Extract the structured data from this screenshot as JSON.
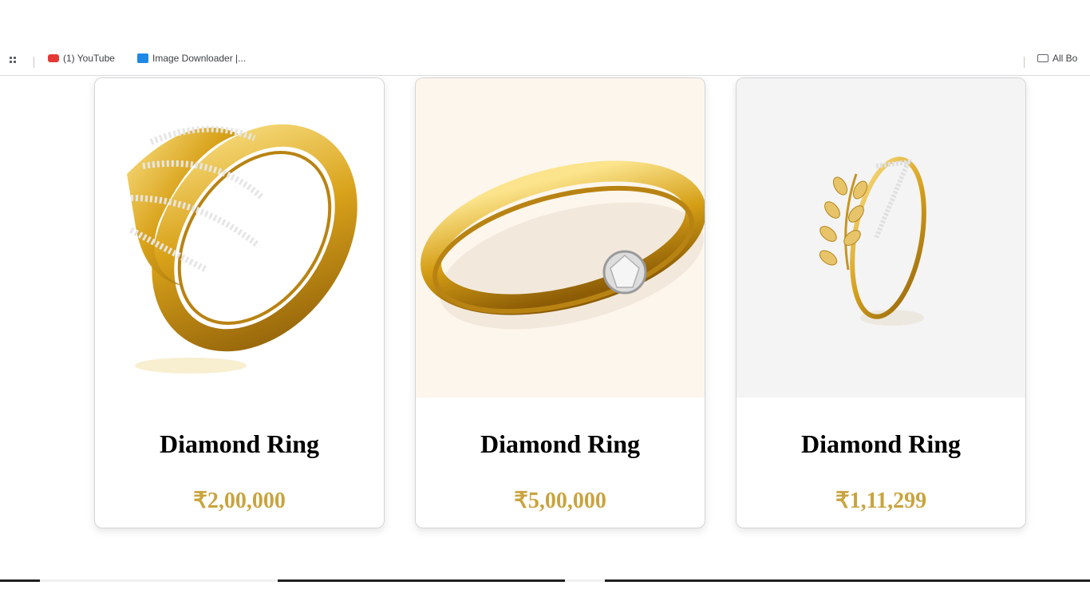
{
  "bookmarks": {
    "items": [
      {
        "icon": "youtube-icon",
        "label": "(1) YouTube"
      },
      {
        "icon": "image-icon",
        "label": "Image Downloader |..."
      }
    ],
    "right_label": "All Bo"
  },
  "products": [
    {
      "title": "Diamond Ring",
      "price": "₹2,00,000"
    },
    {
      "title": "Diamond Ring",
      "price": "₹5,00,000"
    },
    {
      "title": "Diamond Ring",
      "price": "₹1,11,299"
    }
  ],
  "colors": {
    "price": "#c9a43e",
    "gold": "#d4a017",
    "card_border": "#d4d4d4"
  }
}
